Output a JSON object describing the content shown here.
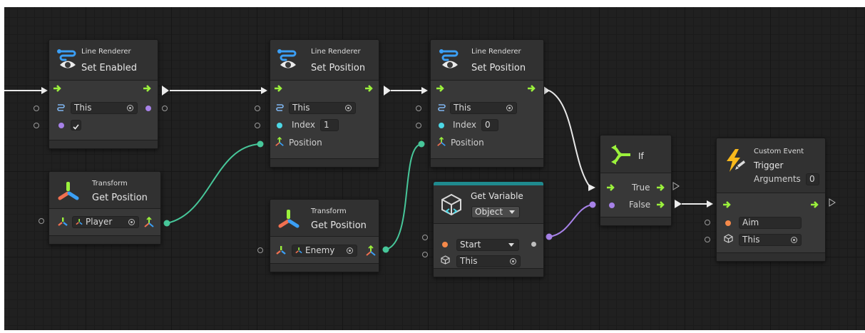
{
  "nodes": {
    "set_enabled": {
      "category": "Line Renderer",
      "title": "Set Enabled",
      "target": "This"
    },
    "set_pos_1": {
      "category": "Line Renderer",
      "title": "Set Position",
      "target": "This",
      "index_label": "Index",
      "index_value": "1",
      "position_label": "Position"
    },
    "set_pos_2": {
      "category": "Line Renderer",
      "title": "Set Position",
      "target": "This",
      "index_label": "Index",
      "index_value": "0",
      "position_label": "Position"
    },
    "get_pos_player": {
      "category": "Transform",
      "title": "Get Position",
      "target": "Player"
    },
    "get_pos_enemy": {
      "category": "Transform",
      "title": "Get Position",
      "target": "Enemy"
    },
    "get_variable": {
      "title": "Get Variable",
      "kind": "Object",
      "name": "Start",
      "target": "This"
    },
    "if_node": {
      "title": "If",
      "true_label": "True",
      "false_label": "False"
    },
    "custom_event": {
      "category": "Custom Event",
      "title": "Trigger",
      "args_label": "Arguments",
      "args_value": "0",
      "arg0": "Aim",
      "target": "This"
    }
  },
  "colors": {
    "canvas": "#202020",
    "node_body": "#383838",
    "control_flow": "#9bf13c",
    "vector_port": "#47c79a",
    "object_port": "#a782e8",
    "string_port": "#f5894a",
    "variable_header": "#1f8a8e",
    "lightning": "#f8b91c"
  },
  "icons": [
    "line-renderer-icon",
    "transform-icon",
    "vector3-icon",
    "variable-cube-icon",
    "if-branch-icon",
    "lightning-icon",
    "target-selector-icon",
    "checkmark-icon",
    "object-cube-icon"
  ]
}
